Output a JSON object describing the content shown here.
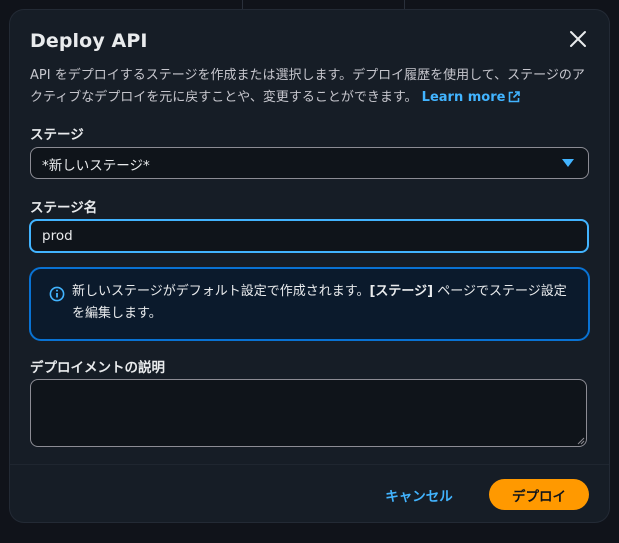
{
  "modal": {
    "title": "Deploy API",
    "description": "API をデプロイするステージを作成または選択します。デプロイ履歴を使用して、ステージのアクティブなデプロイを元に戻すことや、変更することができます。",
    "learn_more": "Learn more"
  },
  "stage": {
    "label": "ステージ",
    "selected": "*新しいステージ*"
  },
  "stage_name": {
    "label": "ステージ名",
    "value": "prod"
  },
  "info": {
    "text_before": "新しいステージがデフォルト設定で作成されます。",
    "text_bold": "[ステージ]",
    "text_after": " ページでステージ設定を編集します。"
  },
  "deployment_description": {
    "label": "デプロイメントの説明",
    "value": ""
  },
  "footer": {
    "cancel_label": "キャンセル",
    "deploy_label": "デプロイ"
  },
  "colors": {
    "accent": "#42b4ff",
    "primary_button": "#ff9900",
    "info_border": "#0972d3",
    "modal_bg": "#161d26"
  },
  "icons": {
    "close": "close-icon",
    "external_link": "external-link-icon",
    "dropdown": "caret-down-icon",
    "info": "info-icon",
    "resize": "resize-grip-icon"
  }
}
